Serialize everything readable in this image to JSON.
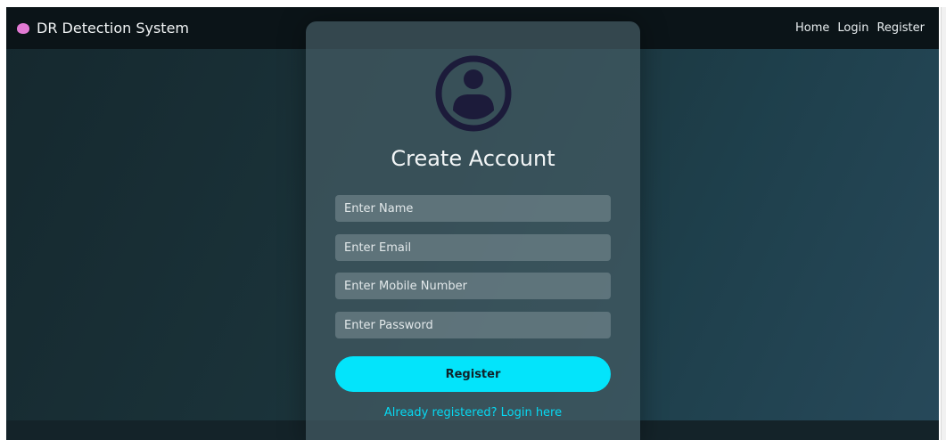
{
  "navbar": {
    "brand_name": "DR Detection System",
    "brand_icon": "brain-icon",
    "links": [
      "Home",
      "Login",
      "Register"
    ]
  },
  "card": {
    "avatar_icon": "user-circle-icon",
    "title": "Create Account",
    "fields": {
      "name_placeholder": "Enter Name",
      "email_placeholder": "Enter Email",
      "mobile_placeholder": "Enter Mobile Number",
      "password_placeholder": "Enter Password"
    },
    "register_label": "Register",
    "login_link": "Already registered? Login here"
  },
  "colors": {
    "accent": "#03e4fb",
    "navbar_bg": "#0b1418",
    "brand_icon": "#e27ad3",
    "avatar": "#1c1b3a"
  }
}
